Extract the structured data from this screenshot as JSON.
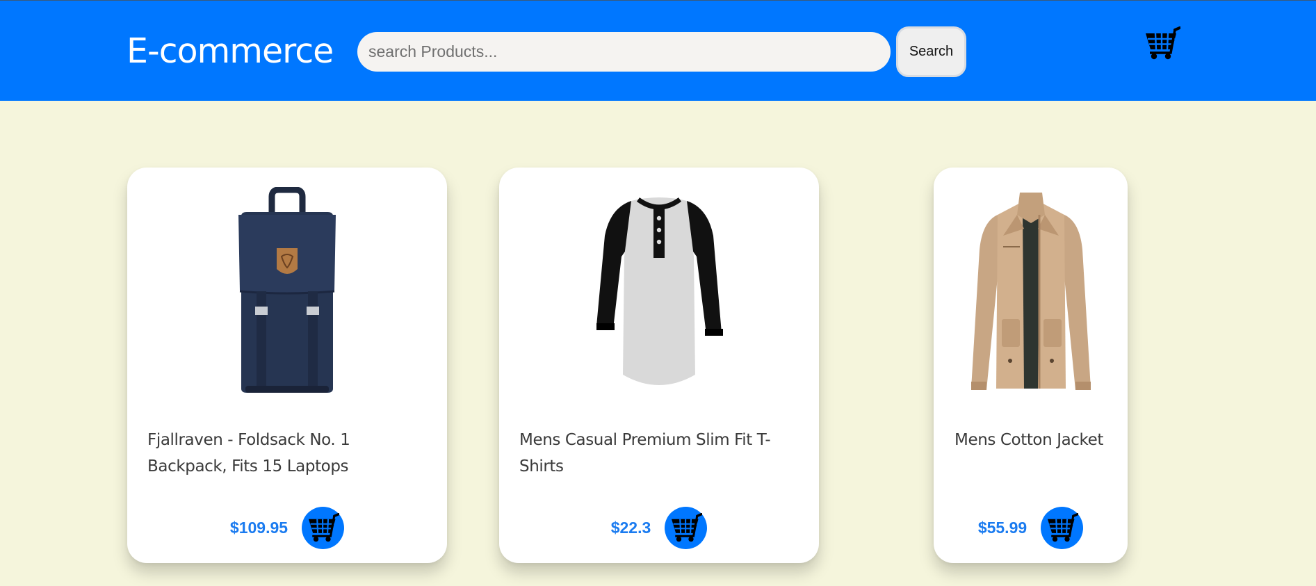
{
  "header": {
    "brand": "E-commerce",
    "search_placeholder": "search Products...",
    "search_button_label": "Search",
    "cart_icon": "shopping-cart-icon"
  },
  "products": [
    {
      "title": "Fjallraven - Foldsack No. 1 Backpack, Fits 15 Laptops",
      "price": "$109.95",
      "image": "navy-backpack"
    },
    {
      "title": "Mens Casual Premium Slim Fit T-Shirts",
      "price": "$22.3",
      "image": "raglan-henley-tshirt"
    },
    {
      "title": "Mens Cotton Jacket",
      "price": "$55.99",
      "image": "khaki-cotton-jacket"
    }
  ],
  "colors": {
    "header_bg": "#0077ff",
    "page_bg": "#f5f5dc",
    "price": "#1a7bf0",
    "card_bg": "#ffffff"
  }
}
